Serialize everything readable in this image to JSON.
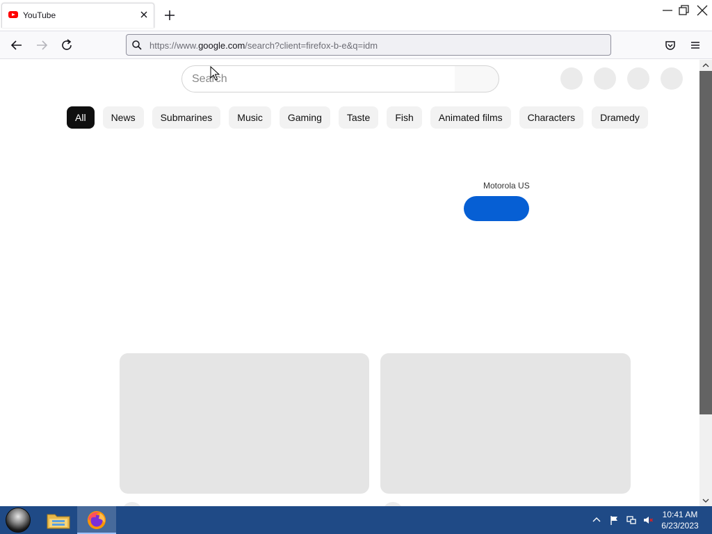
{
  "browser": {
    "tab": {
      "title": "YouTube",
      "favicon": "youtube-icon"
    },
    "url": {
      "prefix": "https://www.",
      "host": "google.com",
      "path": "/search?client=firefox-b-e&q=idm"
    },
    "icons": {
      "back": "arrow-left-icon",
      "forward": "arrow-right-icon",
      "reload": "reload-icon",
      "pocket": "pocket-icon",
      "menu": "hamburger-menu-icon"
    }
  },
  "page": {
    "search": {
      "placeholder": "Search"
    },
    "chips": [
      "All",
      "News",
      "Submarines",
      "Music",
      "Gaming",
      "Taste",
      "Fish",
      "Animated films",
      "Characters",
      "Dramedy"
    ],
    "active_chip": "All",
    "ad": {
      "advertiser": "Motorola US",
      "cta_color": "#065fd4"
    }
  },
  "taskbar": {
    "clock": {
      "time": "10:41 AM",
      "date": "6/23/2023"
    },
    "apps": [
      "file-explorer-icon",
      "firefox-icon"
    ]
  },
  "colors": {
    "taskbar": "#1f4a86",
    "chip_active": "#0f0f0f",
    "chip": "#f2f2f2",
    "youtube_red": "#ff0000"
  }
}
